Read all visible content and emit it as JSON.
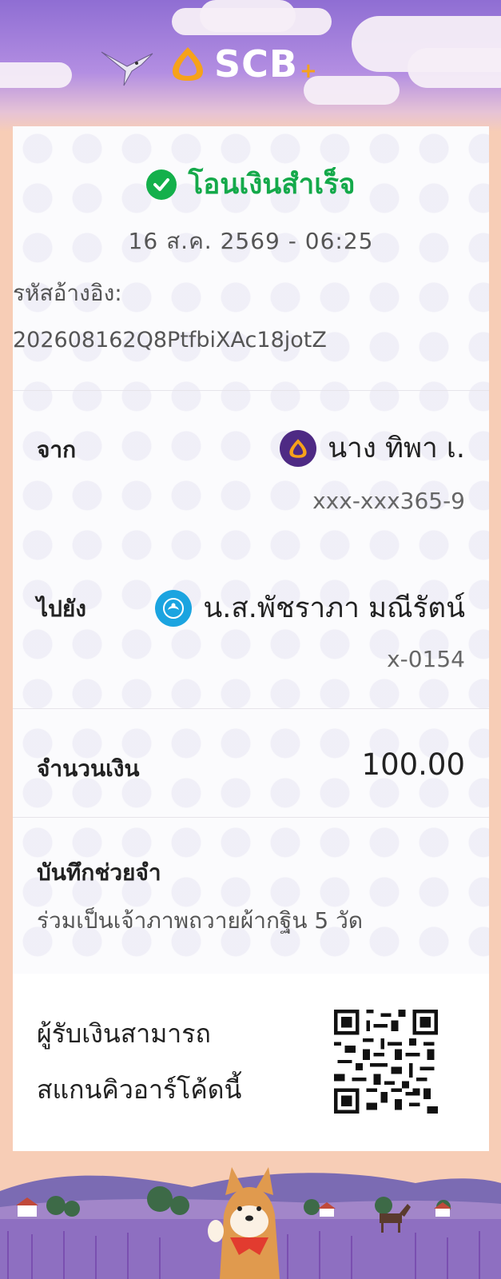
{
  "brand": {
    "name": "SCB",
    "plus": "+",
    "accent": "#f6a21a",
    "sky": "#8f6ed3"
  },
  "status": {
    "text": "โอนเงินสำเร็จ",
    "icon": "check-circle-icon",
    "color": "#14b04b"
  },
  "datetime": "16 ส.ค. 2569 - 06:25",
  "reference": {
    "label": "รหัสอ้างอิง:",
    "value": "202608162Q8PtfbiXAc18jotZ"
  },
  "from": {
    "label": "จาก",
    "name": "นาง ทิพา เ.",
    "account": "xxx-xxx365-9",
    "icon": "scb-bank-icon"
  },
  "to": {
    "label": "ไปยัง",
    "name": "น.ส.พัชราภา มณีรัตน์",
    "account": "x-0154",
    "icon": "krungthai-bank-icon"
  },
  "amount": {
    "label": "จำนวนเงิน",
    "value": "100.00"
  },
  "note": {
    "label": "บันทึกช่วยจำ",
    "value": "ร่วมเป็นเจ้าภาพถวายผ้ากฐิน 5 วัด"
  },
  "qr": {
    "line1": "ผู้รับเงินสามารถ",
    "line2": "สแกนคิวอาร์โค้ดนี้",
    "icon": "qr-code-icon"
  }
}
